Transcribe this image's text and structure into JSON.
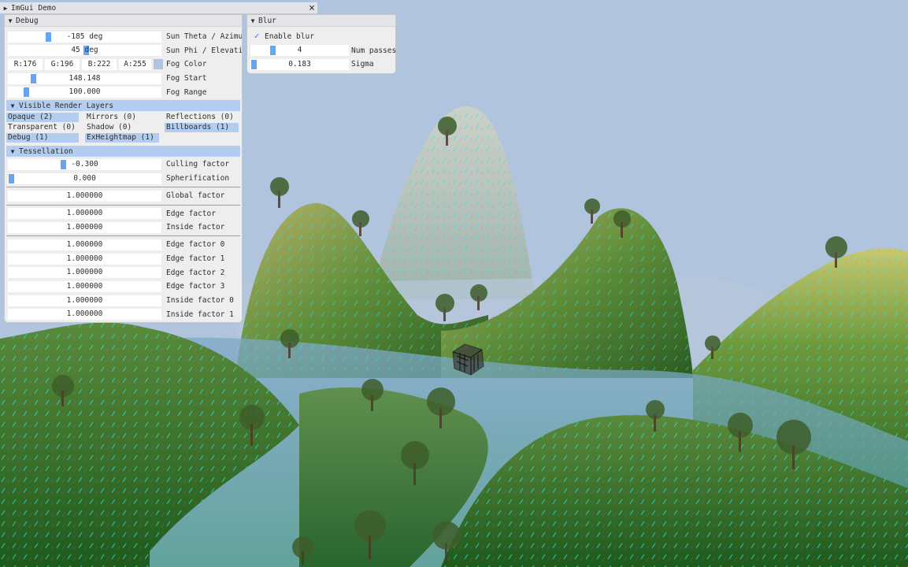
{
  "app": {
    "title": "ImGui Demo"
  },
  "colors": {
    "fog_swatch": "#b0c4de",
    "accent": "#69a4f2",
    "header_bg": "#b3cdf0",
    "sky": "#b0c4de"
  },
  "debug": {
    "title": "Debug",
    "sliders": [
      {
        "value": "-185 deg",
        "label": "Sun Theta / Azimuth",
        "level": 0.25
      },
      {
        "value": "45 deg",
        "label": "Sun Phi / Elevation",
        "level": 0.5
      }
    ],
    "fog_color": {
      "r": "R:176",
      "g": "G:196",
      "b": "B:222",
      "a": "A:255",
      "label": "Fog Color"
    },
    "fog": [
      {
        "value": "148.148",
        "label": "Fog Start",
        "level": 0.15
      },
      {
        "value": "100.000",
        "label": "Fog Range",
        "level": 0.1
      }
    ],
    "render_layers": {
      "title": "Visible Render Layers",
      "items": [
        {
          "label": "Opaque (2)",
          "on": true
        },
        {
          "label": "Mirrors (0)",
          "on": false
        },
        {
          "label": "Reflections (0)",
          "on": false
        },
        {
          "label": "Transparent (0)",
          "on": false
        },
        {
          "label": "Shadow (0)",
          "on": false
        },
        {
          "label": "Billboards (1)",
          "on": true
        },
        {
          "label": "Debug (1)",
          "on": true
        },
        {
          "label": "ExHeightmap (1)",
          "on": true
        }
      ]
    },
    "tessellation": {
      "title": "Tessellation",
      "culling": {
        "value": "-0.300",
        "label": "Culling factor",
        "level": 0.35
      },
      "spherification": {
        "value": "0.000",
        "label": "Spherification",
        "level": 0.0
      },
      "global": {
        "value": "1.000000",
        "label": "Global factor"
      },
      "edge": {
        "value": "1.000000",
        "label": "Edge factor"
      },
      "inside": {
        "value": "1.000000",
        "label": "Inside factor"
      },
      "per_edge": [
        {
          "value": "1.000000",
          "label": "Edge factor 0"
        },
        {
          "value": "1.000000",
          "label": "Edge factor 1"
        },
        {
          "value": "1.000000",
          "label": "Edge factor 2"
        },
        {
          "value": "1.000000",
          "label": "Edge factor 3"
        },
        {
          "value": "1.000000",
          "label": "Inside factor 0"
        },
        {
          "value": "1.000000",
          "label": "Inside factor 1"
        }
      ]
    }
  },
  "blur": {
    "title": "Blur",
    "enable_label": "Enable blur",
    "enabled": true,
    "passes": {
      "value": "4",
      "label": "Num passes",
      "level": 0.2
    },
    "sigma": {
      "value": "0.183",
      "label": "Sigma",
      "level": 0.0
    }
  }
}
